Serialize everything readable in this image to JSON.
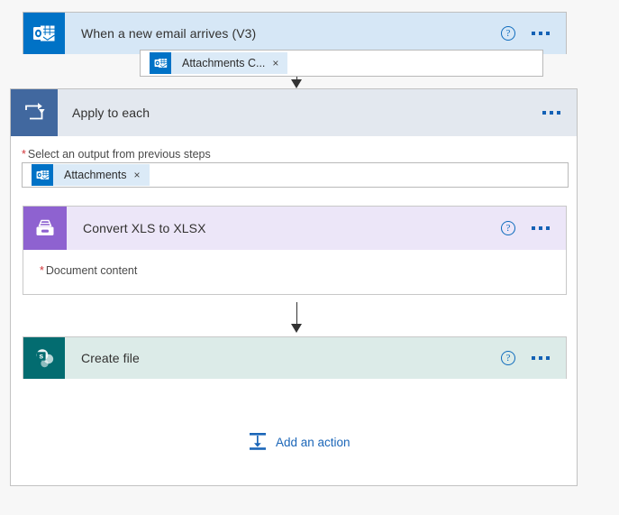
{
  "flow": {
    "trigger": {
      "title": "When a new email arrives (V3)",
      "icon": "outlook-icon",
      "icon_color": "#0072c6",
      "header_color": "#d6e7f6",
      "help_label": "?",
      "menu_label": "•••"
    },
    "connector_top": {
      "add_label": "+",
      "icon": "add-step-icon"
    },
    "apply_to_each": {
      "title": "Apply to each",
      "icon": "loop-icon",
      "icon_color": "#41689f",
      "header_color": "#e3e8ef",
      "menu_label": "•••",
      "field": {
        "required_marker": "*",
        "label": "Select an output from previous steps",
        "token": {
          "text": "Attachments",
          "close": "×",
          "icon": "outlook-icon"
        }
      },
      "convert_action": {
        "title": "Convert XLS to XLSX",
        "icon": "tray-icon",
        "icon_color": "#8e62d0",
        "header_color": "#ece6f8",
        "help_label": "?",
        "menu_label": "•••",
        "field": {
          "required_marker": "*",
          "label": "Document content",
          "token": {
            "text": "Attachments C...",
            "close": "×",
            "icon": "outlook-icon"
          }
        }
      },
      "create_action": {
        "title": "Create file",
        "icon": "sharepoint-icon",
        "icon_color": "#036c70",
        "header_color": "#dcebe8",
        "help_label": "?",
        "menu_label": "•••"
      },
      "add_action": {
        "label": "Add an action",
        "icon": "insert-action-icon",
        "color": "#1b66b8"
      }
    }
  }
}
